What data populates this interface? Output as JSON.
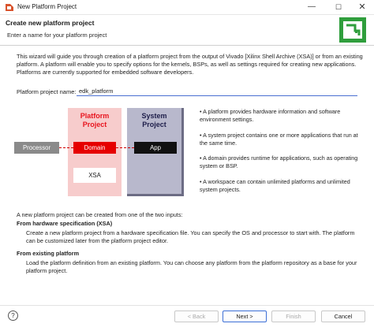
{
  "window": {
    "title": "New Platform Project",
    "minimize_glyph": "—",
    "maximize_glyph": "☐",
    "close_glyph": "✕",
    "icon": "platform-app-icon"
  },
  "header": {
    "title": "Create new platform project",
    "subtitle": "Enter a name for your platform project",
    "logo_icon": "platform-wizard-logo",
    "logo_color": "#2f9e3c"
  },
  "intro_text": "This wizard will guide you through creation of a platform project from the output of Vivado [Xilinx Shell Archive (XSA)] or from an existing platform. A platform will enable you to specify options for the kernels, BSPs, as well as settings required for creating new applications. Platforms are currently supported for embedded software developers.",
  "form": {
    "name_label": "Platform project name:",
    "name_value": "edk_platform"
  },
  "diagram": {
    "platform_project_line1": "Platform",
    "platform_project_line2": "Project",
    "system_project_line1": "System",
    "system_project_line2": "Project",
    "processor": "Processor",
    "domain": "Domain",
    "app": "App",
    "xsa": "XSA",
    "colors": {
      "platform_bg": "#f7cccc",
      "platform_title": "#e8141e",
      "system_bg": "#b8b8cc",
      "domain": "#e60000",
      "app": "#111111",
      "processor": "#8a8a8a"
    }
  },
  "bullets": [
    "• A platform provides hardware information and software environment settings.",
    "• A system project contains one or more applications that run at the same time.",
    "• A domain provides runtime for applications, such as operating system or BSP.",
    "• A workspace can contain unlimited platforms and unlimited system projects."
  ],
  "sections": {
    "intro": "A new platform project can be created from one of the two inputs:",
    "hw_heading": "From hardware specification (XSA)",
    "hw_text": "Create a new platform project from a hardware specification file. You can specify the OS and processor to start with. The platform can be customized later from the platform project editor.",
    "existing_heading": "From existing platform",
    "existing_text": "Load the platform definition from an existing platform. You can choose any platform from the platform repository as a base for your platform project."
  },
  "footer": {
    "help": "?",
    "back": "< Back",
    "next": "Next >",
    "finish": "Finish",
    "cancel": "Cancel"
  }
}
